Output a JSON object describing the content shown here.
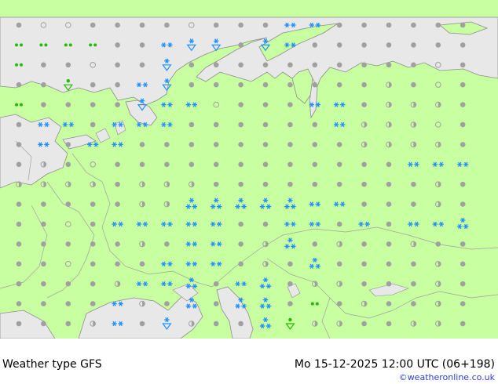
{
  "footer": {
    "title_left": "Weather type   GFS",
    "title_right": "Mo 15-12-2025 12:00 UTC (06+198)",
    "credit": "©weatheronline.co.uk"
  },
  "colors": {
    "land": "#c8ffa0",
    "sea": "#e8e8e8",
    "border": "#a0a0a0",
    "coast": "#8c8c8c",
    "dot": "#a0a0a0",
    "snow": "#1e90ff",
    "rain": "#22bb00"
  },
  "legend_icons": {
    "dot": "overcast-dot-icon",
    "open_dot": "cloudy-circle-icon",
    "half_dot": "partly-cloudy-icon",
    "snow": "snow-icon",
    "snow_shower": "snow-shower-icon",
    "heavy_snow": "heavy-snow-icon",
    "drizzle": "drizzle-icon",
    "rain": "rain-icon",
    "rain_shower": "rain-shower-icon"
  },
  "grid": {
    "cols": 19,
    "rows": 15,
    "rows_symbols": [
      "pooppppoppprrpppppp",
      "ddddpprsspsrppppppp",
      "dppoppsppppppppppop",
      "ppDpprspppppppphpop",
      "dppppsrroppprrphhhp",
      "prrprrrpppppprhhhop",
      "prprrppppppppphhhhp",
      "phpopppppppppppprrr",
      "hhhhphhhppppppppphp",
      "ppppphhHHHHHrrppphp",
      "ppoprrrrrpprrprprrH",
      "ppppphprrphHphpphpp",
      "ppoppprrrphpHpppphp",
      "pppphrrHprHphhppphp",
      "pppprhpHpHHpdphpphp",
      "ppphrpshppHRhhpphhp"
    ]
  }
}
